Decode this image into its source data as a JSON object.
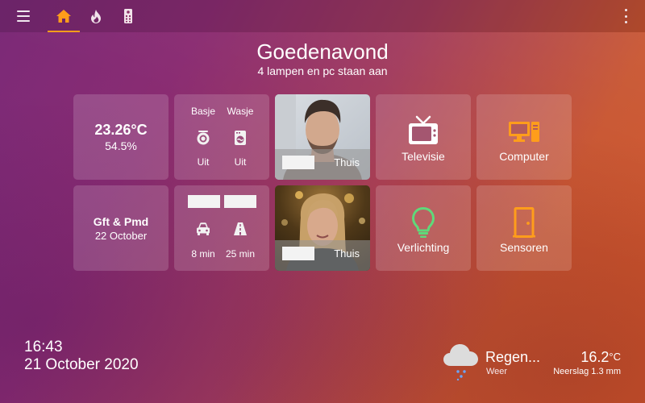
{
  "greeting": {
    "title": "Goedenavond",
    "subtitle": "4 lampen en pc staan aan"
  },
  "nav": {
    "tabs": [
      {
        "icon": "home-icon",
        "active": true
      },
      {
        "icon": "fire-icon",
        "active": false
      },
      {
        "icon": "remote-icon",
        "active": false
      }
    ]
  },
  "climate": {
    "temperature": "23.26°C",
    "humidity": "54.5%"
  },
  "appliances": [
    {
      "label": "Basje",
      "state": "Uit",
      "icon": "dryer-icon"
    },
    {
      "label": "Wasje",
      "state": "Uit",
      "icon": "washing-machine-icon"
    }
  ],
  "persons": [
    {
      "state": "Thuis"
    },
    {
      "state": "Thuis"
    }
  ],
  "tiles": {
    "tv": {
      "label": "Televisie",
      "icon": "television-icon"
    },
    "computer": {
      "label": "Computer",
      "icon": "computer-icon"
    },
    "lights": {
      "label": "Verlichting",
      "icon": "lightbulb-icon"
    },
    "sensors": {
      "label": "Sensoren",
      "icon": "door-icon"
    }
  },
  "waste": {
    "type": "Gft & Pmd",
    "date": "22 October"
  },
  "travel": [
    {
      "time": "8 min",
      "icon": "car-icon"
    },
    {
      "time": "25 min",
      "icon": "highway-icon"
    }
  ],
  "clock": {
    "time": "16:43",
    "date": "21 October 2020"
  },
  "weather": {
    "condition": "Regen...",
    "label": "Weer",
    "temperature": "16.2",
    "unit": "°C",
    "precipitation": "Neerslag 1.3 mm",
    "icon": "rain-cloud-icon"
  },
  "colors": {
    "accent": "#ff9d1b",
    "tile_green": "#5fd97a",
    "tile_orange": "#ff9d1b",
    "card_bg": "rgba(255,255,255,0.16)"
  }
}
